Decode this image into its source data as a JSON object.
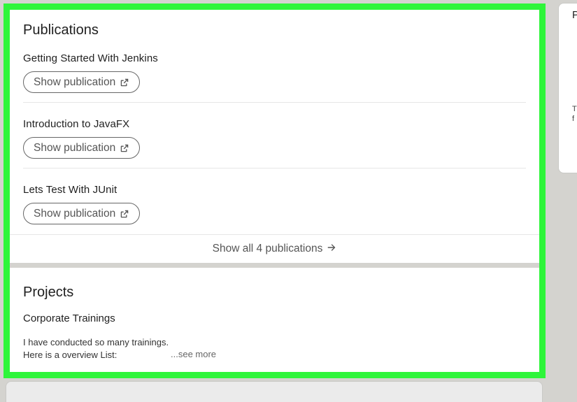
{
  "publications": {
    "title": "Publications",
    "items": [
      {
        "title": "Getting Started With Jenkins",
        "button_label": "Show publication"
      },
      {
        "title": "Introduction to JavaFX",
        "button_label": "Show publication"
      },
      {
        "title": "Lets Test With JUnit",
        "button_label": "Show publication"
      }
    ],
    "show_all_label": "Show all 4 publications",
    "icons": {
      "external": "external-link-icon",
      "arrow": "arrow-right-icon"
    }
  },
  "projects": {
    "title": "Projects",
    "item_title": "Corporate Trainings",
    "description_lines": [
      "I have conducted so many trainings.",
      "Here is a overview List:"
    ],
    "see_more_label": "...see more"
  },
  "side_panel": {
    "heading_fragment": "P",
    "text_fragment": "T\nf"
  },
  "colors": {
    "highlight": "#2ef53a",
    "background": "#d4d3cf",
    "card": "#ffffff"
  }
}
